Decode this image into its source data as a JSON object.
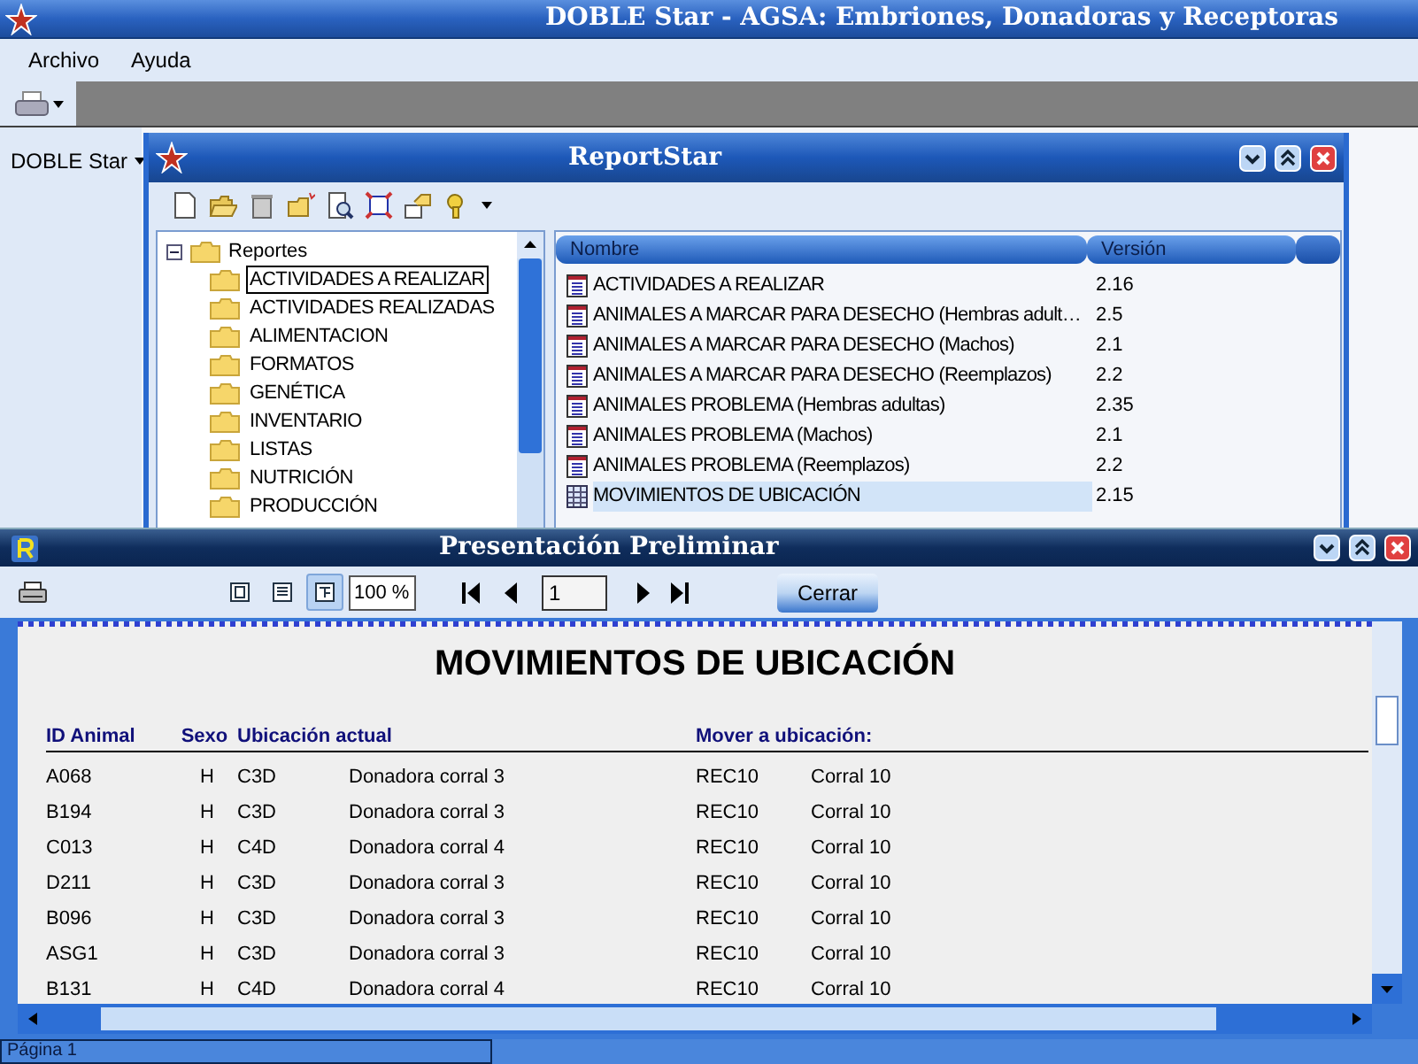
{
  "window": {
    "title": "DOBLE Star - AGSA: Embriones, Donadoras y Receptoras"
  },
  "menu": [
    "Archivo",
    "Ayuda"
  ],
  "side_panel": {
    "label": "DOBLE Star"
  },
  "report_window": {
    "title": "ReportStar",
    "tree": {
      "label": "Reportes",
      "expanded": true,
      "children": [
        {
          "label": "ACTIVIDADES A REALIZAR",
          "selected": true
        },
        {
          "label": "ACTIVIDADES REALIZADAS",
          "selected": false
        },
        {
          "label": "ALIMENTACION",
          "selected": false
        },
        {
          "label": "FORMATOS",
          "selected": false
        },
        {
          "label": "GENÉTICA",
          "selected": false
        },
        {
          "label": "INVENTARIO",
          "selected": false
        },
        {
          "label": "LISTAS",
          "selected": false
        },
        {
          "label": "NUTRICIÓN",
          "selected": false
        },
        {
          "label": "PRODUCCIÓN",
          "selected": false
        }
      ]
    },
    "list": {
      "columns": [
        "Nombre",
        "Versión"
      ],
      "rows": [
        {
          "name": "ACTIVIDADES A REALIZAR",
          "version": "2.16",
          "selected": false
        },
        {
          "name": "ANIMALES A MARCAR PARA DESECHO (Hembras adult…",
          "version": "2.5",
          "selected": false
        },
        {
          "name": "ANIMALES A MARCAR PARA DESECHO (Machos)",
          "version": "2.1",
          "selected": false
        },
        {
          "name": "ANIMALES A MARCAR PARA DESECHO (Reemplazos)",
          "version": "2.2",
          "selected": false
        },
        {
          "name": "ANIMALES PROBLEMA (Hembras adultas)",
          "version": "2.35",
          "selected": false
        },
        {
          "name": "ANIMALES PROBLEMA (Machos)",
          "version": "2.1",
          "selected": false
        },
        {
          "name": "ANIMALES PROBLEMA (Reemplazos)",
          "version": "2.2",
          "selected": false
        },
        {
          "name": "MOVIMIENTOS DE UBICACIÓN",
          "version": "2.15",
          "selected": true
        }
      ]
    }
  },
  "preview_window": {
    "title": "Presentación Preliminar",
    "view_modes": [
      {
        "selected": false
      },
      {
        "selected": false
      },
      {
        "selected": true
      }
    ],
    "zoom": "100 %",
    "page": "1",
    "close_button": "Cerrar",
    "report": {
      "title": "MOVIMIENTOS DE UBICACIÓN",
      "headers": [
        "ID Animal",
        "Sexo",
        "Ubicación actual",
        "Mover a ubicación:"
      ],
      "rows": [
        [
          "A068",
          "H",
          "C3D",
          "Donadora corral 3",
          "REC10",
          "Corral 10"
        ],
        [
          "B194",
          "H",
          "C3D",
          "Donadora corral 3",
          "REC10",
          "Corral 10"
        ],
        [
          "C013",
          "H",
          "C4D",
          "Donadora corral 4",
          "REC10",
          "Corral 10"
        ],
        [
          "D211",
          "H",
          "C3D",
          "Donadora corral 3",
          "REC10",
          "Corral 10"
        ],
        [
          "B096",
          "H",
          "C3D",
          "Donadora corral 3",
          "REC10",
          "Corral 10"
        ],
        [
          "ASG1",
          "H",
          "C3D",
          "Donadora corral 3",
          "REC10",
          "Corral 10"
        ],
        [
          "B131",
          "H",
          "C4D",
          "Donadora corral 4",
          "REC10",
          "Corral 10"
        ]
      ]
    },
    "status": "Página 1"
  }
}
